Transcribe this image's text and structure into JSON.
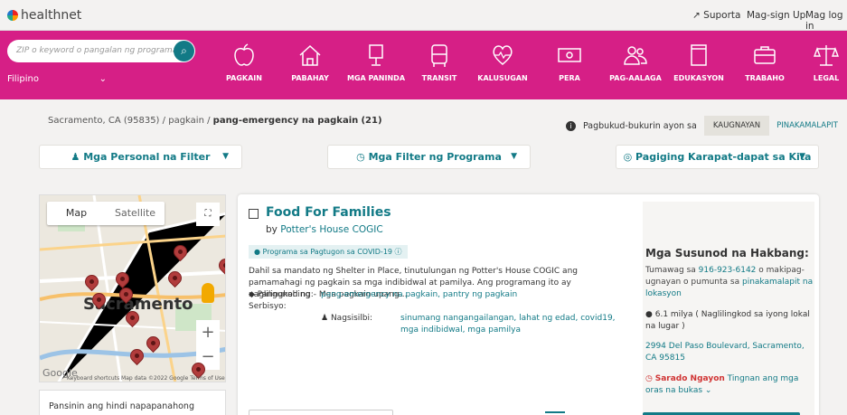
{
  "topbar": {
    "logo_text": "healthnet",
    "support_label": "Suporta",
    "signup_label": "Mag-sign Up",
    "login_label": "Mag log in"
  },
  "search": {
    "placeholder": "ZIP o keyword o pangalan ng programa",
    "language": "Filipino"
  },
  "categories": [
    {
      "icon": "apple-icon",
      "label": "PAGKAIN"
    },
    {
      "icon": "house-icon",
      "label": "PABAHAY"
    },
    {
      "icon": "lamp-icon",
      "label": "MGA PANINDA"
    },
    {
      "icon": "bus-icon",
      "label": "TRANSIT"
    },
    {
      "icon": "heart-pulse-icon",
      "label": "KALUSUGAN"
    },
    {
      "icon": "money-icon",
      "label": "PERA"
    },
    {
      "icon": "people-icon",
      "label": "PAG-AALAGA"
    },
    {
      "icon": "book-icon",
      "label": "EDUKASYON"
    },
    {
      "icon": "briefcase-icon",
      "label": "TRABAHO"
    },
    {
      "icon": "scale-icon",
      "label": "LEGAL"
    }
  ],
  "breadcrumb": {
    "location": "Sacramento, CA (95835)",
    "separator": "/",
    "category": "pagkain",
    "current": "pang-emergency na pagkain",
    "count": "(21)"
  },
  "sort": {
    "label": "Pagbukud-bukurin ayon sa",
    "option_relevance": "KAUGNAYAN",
    "option_nearest": "PINAKAMALAPIT"
  },
  "filters": {
    "personal": "Mga Personal na Filter",
    "program": "Mga Filter ng Programa",
    "eligibility": "Pagiging Karapat-dapat sa Kita"
  },
  "map": {
    "tab_map": "Map",
    "tab_satellite": "Satellite",
    "city_label": "Sacramento",
    "google": "Google",
    "footer": "Keyboard shortcuts   Map data ©2022 Google   Terms of Use",
    "zoom_in": "+",
    "zoom_out": "−"
  },
  "notice": {
    "text": "Pansinin ang hindi napapanahong"
  },
  "result": {
    "title": "Food For Families",
    "by_prefix": "by",
    "provider": "Potter's House COGIC",
    "covid_badge": "Programa sa Pagtugon sa COVID-19",
    "description": "Dahil sa mandato ng Shelter in Place, tinutulungan ng Potter's House COGIC ang pamamahagi ng pagkain sa mga indibidwal at pamilya. Ang programang ito ay naglilingkod ng:- Mga pagkain upang…",
    "main_service_label": "Pangunahing Serbisyo:",
    "main_services": "pang-emergency na pagkain, pantry ng pagkain",
    "serves_label": "Nagsisilbi:",
    "serves": "sinumang nangangailangan, lahat ng edad, covid19, mga indibidwal, mga pamilya"
  },
  "next_steps": {
    "title": "Mga Susunod na Hakbang:",
    "call_prefix": "Tumawag sa",
    "phone": "916-923-6142",
    "call_middle": "o makipag-ugnayan o pumunta sa",
    "nearest_location": "pinakamalapit na lokasyon",
    "distance": "6.1 milya ( Naglilingkod sa iyong lokal na lugar )",
    "address": "2994 Del Paso Boulevard, Sacramento, CA 95815",
    "status": "Sarado Ngayon",
    "hours_link": "Tingnan ang mga oras na bukas"
  },
  "colors": {
    "brand_magenta": "#d61f86",
    "teal": "#127a86",
    "closed_red": "#d03434",
    "pin_red": "#b13c3c"
  }
}
